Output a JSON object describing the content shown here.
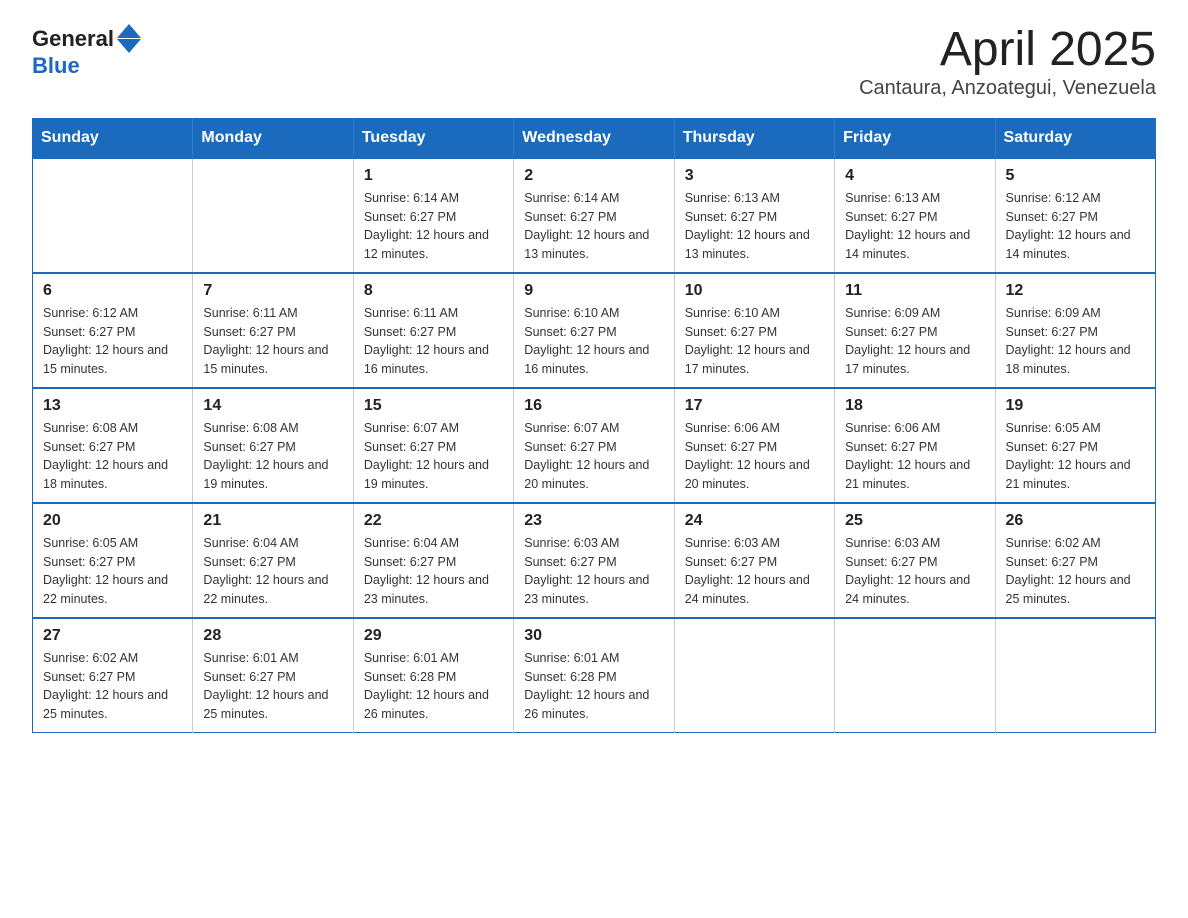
{
  "logo": {
    "text_general": "General",
    "text_blue": "Blue",
    "triangle": "▲"
  },
  "title": "April 2025",
  "subtitle": "Cantaura, Anzoategui, Venezuela",
  "days_of_week": [
    "Sunday",
    "Monday",
    "Tuesday",
    "Wednesday",
    "Thursday",
    "Friday",
    "Saturday"
  ],
  "weeks": [
    [
      {
        "day": "",
        "info": ""
      },
      {
        "day": "",
        "info": ""
      },
      {
        "day": "1",
        "info": "Sunrise: 6:14 AM\nSunset: 6:27 PM\nDaylight: 12 hours and 12 minutes."
      },
      {
        "day": "2",
        "info": "Sunrise: 6:14 AM\nSunset: 6:27 PM\nDaylight: 12 hours and 13 minutes."
      },
      {
        "day": "3",
        "info": "Sunrise: 6:13 AM\nSunset: 6:27 PM\nDaylight: 12 hours and 13 minutes."
      },
      {
        "day": "4",
        "info": "Sunrise: 6:13 AM\nSunset: 6:27 PM\nDaylight: 12 hours and 14 minutes."
      },
      {
        "day": "5",
        "info": "Sunrise: 6:12 AM\nSunset: 6:27 PM\nDaylight: 12 hours and 14 minutes."
      }
    ],
    [
      {
        "day": "6",
        "info": "Sunrise: 6:12 AM\nSunset: 6:27 PM\nDaylight: 12 hours and 15 minutes."
      },
      {
        "day": "7",
        "info": "Sunrise: 6:11 AM\nSunset: 6:27 PM\nDaylight: 12 hours and 15 minutes."
      },
      {
        "day": "8",
        "info": "Sunrise: 6:11 AM\nSunset: 6:27 PM\nDaylight: 12 hours and 16 minutes."
      },
      {
        "day": "9",
        "info": "Sunrise: 6:10 AM\nSunset: 6:27 PM\nDaylight: 12 hours and 16 minutes."
      },
      {
        "day": "10",
        "info": "Sunrise: 6:10 AM\nSunset: 6:27 PM\nDaylight: 12 hours and 17 minutes."
      },
      {
        "day": "11",
        "info": "Sunrise: 6:09 AM\nSunset: 6:27 PM\nDaylight: 12 hours and 17 minutes."
      },
      {
        "day": "12",
        "info": "Sunrise: 6:09 AM\nSunset: 6:27 PM\nDaylight: 12 hours and 18 minutes."
      }
    ],
    [
      {
        "day": "13",
        "info": "Sunrise: 6:08 AM\nSunset: 6:27 PM\nDaylight: 12 hours and 18 minutes."
      },
      {
        "day": "14",
        "info": "Sunrise: 6:08 AM\nSunset: 6:27 PM\nDaylight: 12 hours and 19 minutes."
      },
      {
        "day": "15",
        "info": "Sunrise: 6:07 AM\nSunset: 6:27 PM\nDaylight: 12 hours and 19 minutes."
      },
      {
        "day": "16",
        "info": "Sunrise: 6:07 AM\nSunset: 6:27 PM\nDaylight: 12 hours and 20 minutes."
      },
      {
        "day": "17",
        "info": "Sunrise: 6:06 AM\nSunset: 6:27 PM\nDaylight: 12 hours and 20 minutes."
      },
      {
        "day": "18",
        "info": "Sunrise: 6:06 AM\nSunset: 6:27 PM\nDaylight: 12 hours and 21 minutes."
      },
      {
        "day": "19",
        "info": "Sunrise: 6:05 AM\nSunset: 6:27 PM\nDaylight: 12 hours and 21 minutes."
      }
    ],
    [
      {
        "day": "20",
        "info": "Sunrise: 6:05 AM\nSunset: 6:27 PM\nDaylight: 12 hours and 22 minutes."
      },
      {
        "day": "21",
        "info": "Sunrise: 6:04 AM\nSunset: 6:27 PM\nDaylight: 12 hours and 22 minutes."
      },
      {
        "day": "22",
        "info": "Sunrise: 6:04 AM\nSunset: 6:27 PM\nDaylight: 12 hours and 23 minutes."
      },
      {
        "day": "23",
        "info": "Sunrise: 6:03 AM\nSunset: 6:27 PM\nDaylight: 12 hours and 23 minutes."
      },
      {
        "day": "24",
        "info": "Sunrise: 6:03 AM\nSunset: 6:27 PM\nDaylight: 12 hours and 24 minutes."
      },
      {
        "day": "25",
        "info": "Sunrise: 6:03 AM\nSunset: 6:27 PM\nDaylight: 12 hours and 24 minutes."
      },
      {
        "day": "26",
        "info": "Sunrise: 6:02 AM\nSunset: 6:27 PM\nDaylight: 12 hours and 25 minutes."
      }
    ],
    [
      {
        "day": "27",
        "info": "Sunrise: 6:02 AM\nSunset: 6:27 PM\nDaylight: 12 hours and 25 minutes."
      },
      {
        "day": "28",
        "info": "Sunrise: 6:01 AM\nSunset: 6:27 PM\nDaylight: 12 hours and 25 minutes."
      },
      {
        "day": "29",
        "info": "Sunrise: 6:01 AM\nSunset: 6:28 PM\nDaylight: 12 hours and 26 minutes."
      },
      {
        "day": "30",
        "info": "Sunrise: 6:01 AM\nSunset: 6:28 PM\nDaylight: 12 hours and 26 minutes."
      },
      {
        "day": "",
        "info": ""
      },
      {
        "day": "",
        "info": ""
      },
      {
        "day": "",
        "info": ""
      }
    ]
  ]
}
